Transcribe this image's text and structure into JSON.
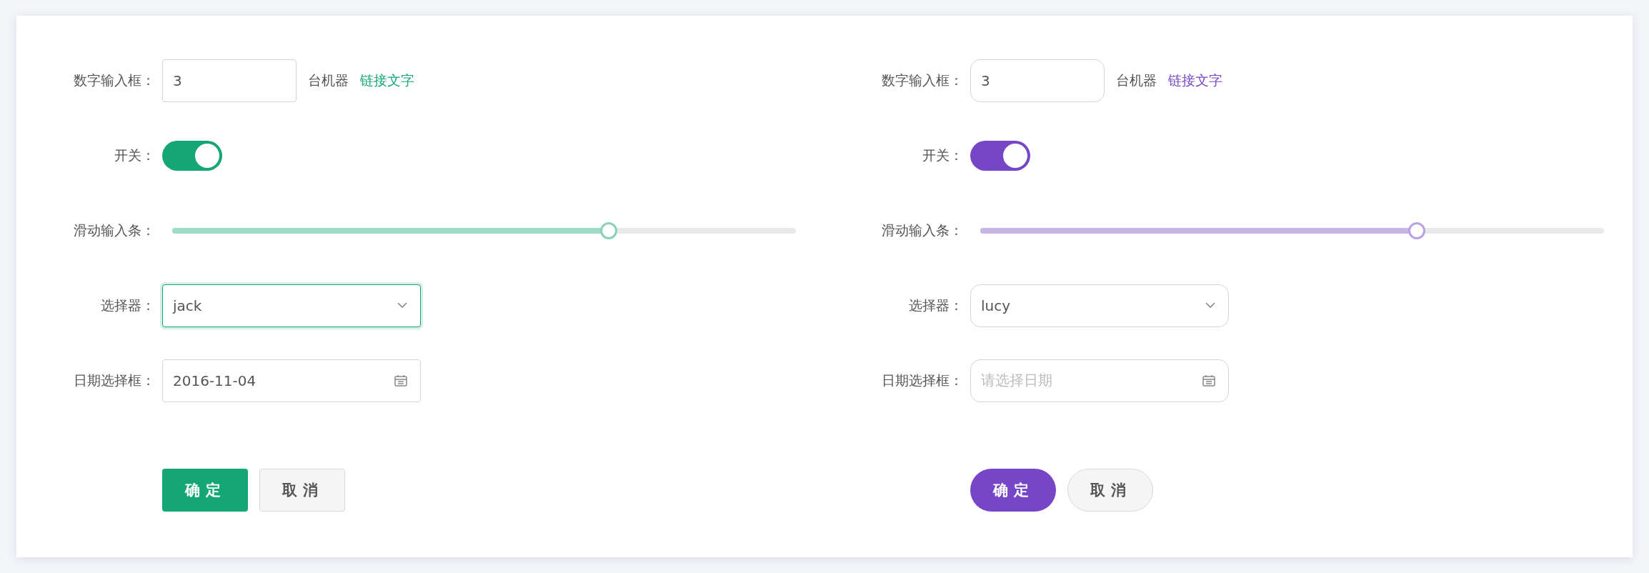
{
  "forms": [
    {
      "color": "#14a675",
      "kind": "square",
      "number_input": {
        "label": "数字输入框：",
        "value": "3",
        "unit": "台机器",
        "link": "链接文字"
      },
      "switch": {
        "label": "开关：",
        "on": true
      },
      "slider": {
        "label": "滑动输入条：",
        "level": 0.7
      },
      "select": {
        "label": "选择器：",
        "value": "jack",
        "focused": true
      },
      "date": {
        "label": "日期选择框：",
        "value": "2016-11-04"
      },
      "buttons": [
        {
          "kind": "primary",
          "label": "确定"
        },
        {
          "kind": "default",
          "label": "取消"
        }
      ]
    },
    {
      "color": "#7646c6",
      "kind": "round",
      "number_input": {
        "label": "数字输入框：",
        "value": "3",
        "unit": "台机器",
        "link": "链接文字"
      },
      "switch": {
        "label": "开关：",
        "on": true
      },
      "slider": {
        "label": "滑动输入条：",
        "level": 0.7
      },
      "select": {
        "label": "选择器：",
        "value": "lucy",
        "focused": false
      },
      "date": {
        "label": "日期选择框：",
        "placeholder": "请选择日期"
      },
      "buttons": [
        {
          "kind": "primary",
          "label": "确定"
        },
        {
          "kind": "default",
          "label": "取消"
        }
      ]
    }
  ]
}
